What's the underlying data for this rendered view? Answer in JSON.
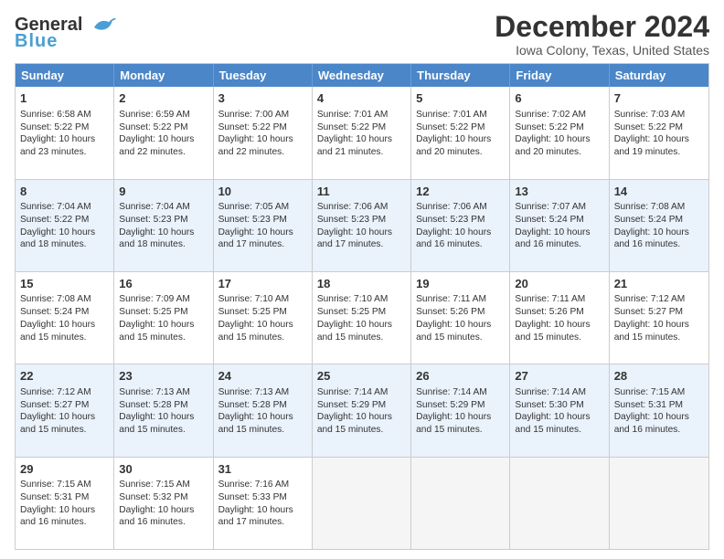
{
  "logo": {
    "line1": "General",
    "line2": "Blue"
  },
  "title": "December 2024",
  "subtitle": "Iowa Colony, Texas, United States",
  "weekdays": [
    "Sunday",
    "Monday",
    "Tuesday",
    "Wednesday",
    "Thursday",
    "Friday",
    "Saturday"
  ],
  "weeks": [
    [
      {
        "day": "1",
        "lines": [
          "Sunrise: 6:58 AM",
          "Sunset: 5:22 PM",
          "Daylight: 10 hours",
          "and 23 minutes."
        ]
      },
      {
        "day": "2",
        "lines": [
          "Sunrise: 6:59 AM",
          "Sunset: 5:22 PM",
          "Daylight: 10 hours",
          "and 22 minutes."
        ]
      },
      {
        "day": "3",
        "lines": [
          "Sunrise: 7:00 AM",
          "Sunset: 5:22 PM",
          "Daylight: 10 hours",
          "and 22 minutes."
        ]
      },
      {
        "day": "4",
        "lines": [
          "Sunrise: 7:01 AM",
          "Sunset: 5:22 PM",
          "Daylight: 10 hours",
          "and 21 minutes."
        ]
      },
      {
        "day": "5",
        "lines": [
          "Sunrise: 7:01 AM",
          "Sunset: 5:22 PM",
          "Daylight: 10 hours",
          "and 20 minutes."
        ]
      },
      {
        "day": "6",
        "lines": [
          "Sunrise: 7:02 AM",
          "Sunset: 5:22 PM",
          "Daylight: 10 hours",
          "and 20 minutes."
        ]
      },
      {
        "day": "7",
        "lines": [
          "Sunrise: 7:03 AM",
          "Sunset: 5:22 PM",
          "Daylight: 10 hours",
          "and 19 minutes."
        ]
      }
    ],
    [
      {
        "day": "8",
        "lines": [
          "Sunrise: 7:04 AM",
          "Sunset: 5:22 PM",
          "Daylight: 10 hours",
          "and 18 minutes."
        ]
      },
      {
        "day": "9",
        "lines": [
          "Sunrise: 7:04 AM",
          "Sunset: 5:23 PM",
          "Daylight: 10 hours",
          "and 18 minutes."
        ]
      },
      {
        "day": "10",
        "lines": [
          "Sunrise: 7:05 AM",
          "Sunset: 5:23 PM",
          "Daylight: 10 hours",
          "and 17 minutes."
        ]
      },
      {
        "day": "11",
        "lines": [
          "Sunrise: 7:06 AM",
          "Sunset: 5:23 PM",
          "Daylight: 10 hours",
          "and 17 minutes."
        ]
      },
      {
        "day": "12",
        "lines": [
          "Sunrise: 7:06 AM",
          "Sunset: 5:23 PM",
          "Daylight: 10 hours",
          "and 16 minutes."
        ]
      },
      {
        "day": "13",
        "lines": [
          "Sunrise: 7:07 AM",
          "Sunset: 5:24 PM",
          "Daylight: 10 hours",
          "and 16 minutes."
        ]
      },
      {
        "day": "14",
        "lines": [
          "Sunrise: 7:08 AM",
          "Sunset: 5:24 PM",
          "Daylight: 10 hours",
          "and 16 minutes."
        ]
      }
    ],
    [
      {
        "day": "15",
        "lines": [
          "Sunrise: 7:08 AM",
          "Sunset: 5:24 PM",
          "Daylight: 10 hours",
          "and 15 minutes."
        ]
      },
      {
        "day": "16",
        "lines": [
          "Sunrise: 7:09 AM",
          "Sunset: 5:25 PM",
          "Daylight: 10 hours",
          "and 15 minutes."
        ]
      },
      {
        "day": "17",
        "lines": [
          "Sunrise: 7:10 AM",
          "Sunset: 5:25 PM",
          "Daylight: 10 hours",
          "and 15 minutes."
        ]
      },
      {
        "day": "18",
        "lines": [
          "Sunrise: 7:10 AM",
          "Sunset: 5:25 PM",
          "Daylight: 10 hours",
          "and 15 minutes."
        ]
      },
      {
        "day": "19",
        "lines": [
          "Sunrise: 7:11 AM",
          "Sunset: 5:26 PM",
          "Daylight: 10 hours",
          "and 15 minutes."
        ]
      },
      {
        "day": "20",
        "lines": [
          "Sunrise: 7:11 AM",
          "Sunset: 5:26 PM",
          "Daylight: 10 hours",
          "and 15 minutes."
        ]
      },
      {
        "day": "21",
        "lines": [
          "Sunrise: 7:12 AM",
          "Sunset: 5:27 PM",
          "Daylight: 10 hours",
          "and 15 minutes."
        ]
      }
    ],
    [
      {
        "day": "22",
        "lines": [
          "Sunrise: 7:12 AM",
          "Sunset: 5:27 PM",
          "Daylight: 10 hours",
          "and 15 minutes."
        ]
      },
      {
        "day": "23",
        "lines": [
          "Sunrise: 7:13 AM",
          "Sunset: 5:28 PM",
          "Daylight: 10 hours",
          "and 15 minutes."
        ]
      },
      {
        "day": "24",
        "lines": [
          "Sunrise: 7:13 AM",
          "Sunset: 5:28 PM",
          "Daylight: 10 hours",
          "and 15 minutes."
        ]
      },
      {
        "day": "25",
        "lines": [
          "Sunrise: 7:14 AM",
          "Sunset: 5:29 PM",
          "Daylight: 10 hours",
          "and 15 minutes."
        ]
      },
      {
        "day": "26",
        "lines": [
          "Sunrise: 7:14 AM",
          "Sunset: 5:29 PM",
          "Daylight: 10 hours",
          "and 15 minutes."
        ]
      },
      {
        "day": "27",
        "lines": [
          "Sunrise: 7:14 AM",
          "Sunset: 5:30 PM",
          "Daylight: 10 hours",
          "and 15 minutes."
        ]
      },
      {
        "day": "28",
        "lines": [
          "Sunrise: 7:15 AM",
          "Sunset: 5:31 PM",
          "Daylight: 10 hours",
          "and 16 minutes."
        ]
      }
    ],
    [
      {
        "day": "29",
        "lines": [
          "Sunrise: 7:15 AM",
          "Sunset: 5:31 PM",
          "Daylight: 10 hours",
          "and 16 minutes."
        ]
      },
      {
        "day": "30",
        "lines": [
          "Sunrise: 7:15 AM",
          "Sunset: 5:32 PM",
          "Daylight: 10 hours",
          "and 16 minutes."
        ]
      },
      {
        "day": "31",
        "lines": [
          "Sunrise: 7:16 AM",
          "Sunset: 5:33 PM",
          "Daylight: 10 hours",
          "and 17 minutes."
        ]
      },
      {
        "day": "",
        "lines": []
      },
      {
        "day": "",
        "lines": []
      },
      {
        "day": "",
        "lines": []
      },
      {
        "day": "",
        "lines": []
      }
    ]
  ],
  "alt_rows": [
    1,
    3
  ],
  "colors": {
    "header_bg": "#4a86c8",
    "alt_row_bg": "#eaf2fb",
    "normal_row_bg": "#ffffff",
    "empty_bg": "#f5f5f5"
  }
}
